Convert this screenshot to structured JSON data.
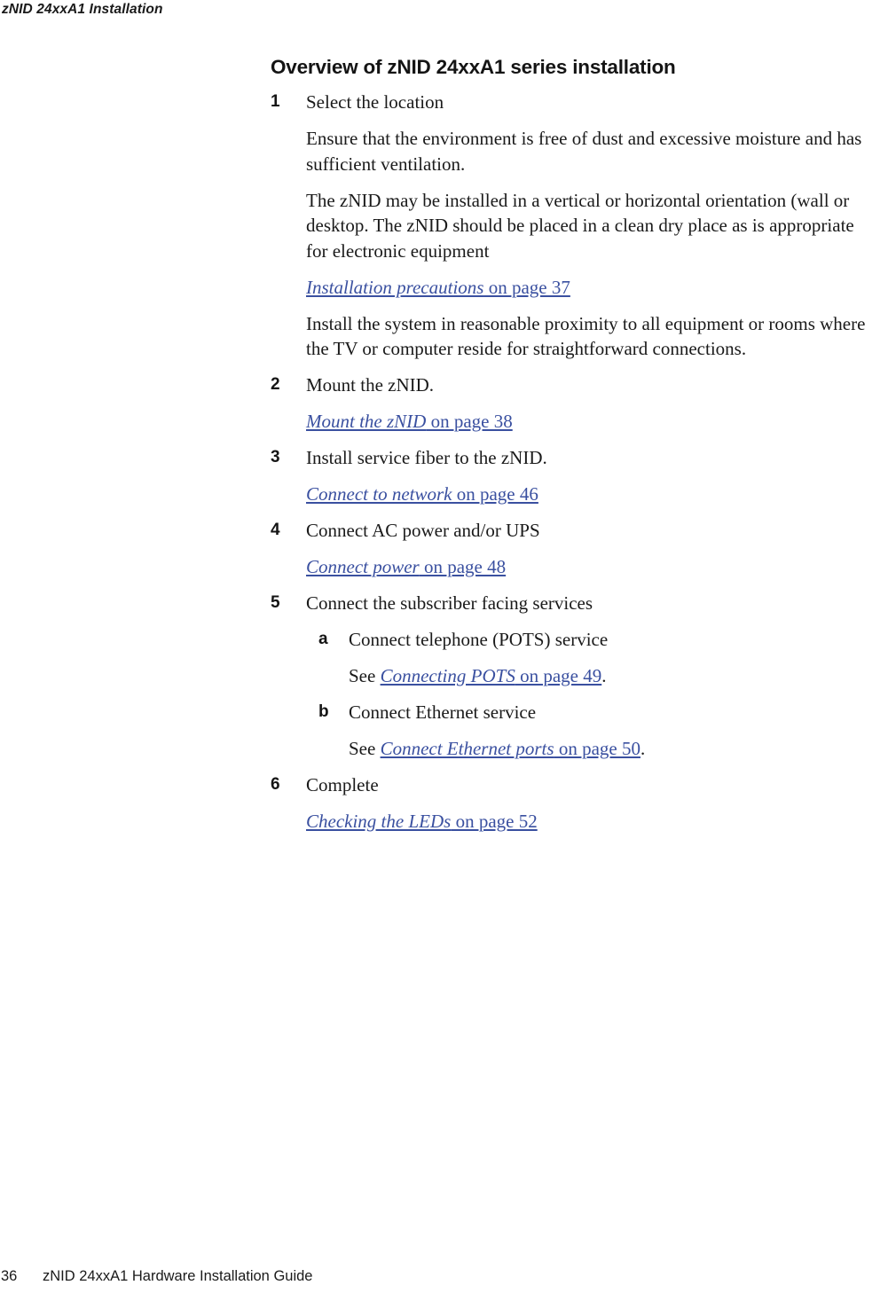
{
  "header": {
    "running_title": "zNID 24xxA1 Installation"
  },
  "main": {
    "section_title": "Overview of zNID 24xxA1 series installation",
    "steps": [
      {
        "num": "1",
        "text": "Select the location",
        "paragraphs": [
          "Ensure that the environment is free of dust and excessive moisture and has sufficient ventilation.",
          "The zNID may be installed in a vertical or horizontal orientation (wall or desktop. The zNID should be placed in a clean dry place as is appropriate for electronic equipment"
        ],
        "xref": {
          "lead": "",
          "title": "Installation precautions",
          "suffix": " on page 37",
          "period": ""
        },
        "trailing_paragraph": "Install the system in reasonable proximity to all equipment or rooms where the TV or computer reside for straightforward connections."
      },
      {
        "num": "2",
        "text": "Mount the zNID.",
        "xref": {
          "lead": "",
          "title": "Mount the zNID",
          "suffix": " on page 38",
          "period": ""
        }
      },
      {
        "num": "3",
        "text": "Install service fiber to the zNID.",
        "xref": {
          "lead": "",
          "title": "Connect to network",
          "suffix": " on page 46",
          "period": ""
        }
      },
      {
        "num": "4",
        "text": "Connect AC power and/or UPS",
        "xref": {
          "lead": "",
          "title": "Connect power",
          "suffix": " on page 48",
          "period": ""
        }
      },
      {
        "num": "5",
        "text": "Connect the subscriber facing services",
        "substeps": [
          {
            "num": "a",
            "text": "Connect telephone (POTS) service",
            "xref": {
              "lead": "See ",
              "title": "Connecting POTS",
              "suffix": " on page 49",
              "period": "."
            }
          },
          {
            "num": "b",
            "text": "Connect Ethernet service",
            "xref": {
              "lead": "See ",
              "title": "Connect Ethernet ports",
              "suffix": " on page 50",
              "period": "."
            }
          }
        ]
      },
      {
        "num": "6",
        "text": "Complete",
        "xref": {
          "lead": "",
          "title": "Checking the LEDs",
          "suffix": " on page 52",
          "period": ""
        }
      }
    ]
  },
  "footer": {
    "page_number": "36",
    "guide_title": "zNID 24xxA1 Hardware Installation Guide"
  },
  "colors": {
    "link": "#3a50a0",
    "text": "#1a1a1a",
    "heading": "#141414",
    "background": "#ffffff"
  }
}
